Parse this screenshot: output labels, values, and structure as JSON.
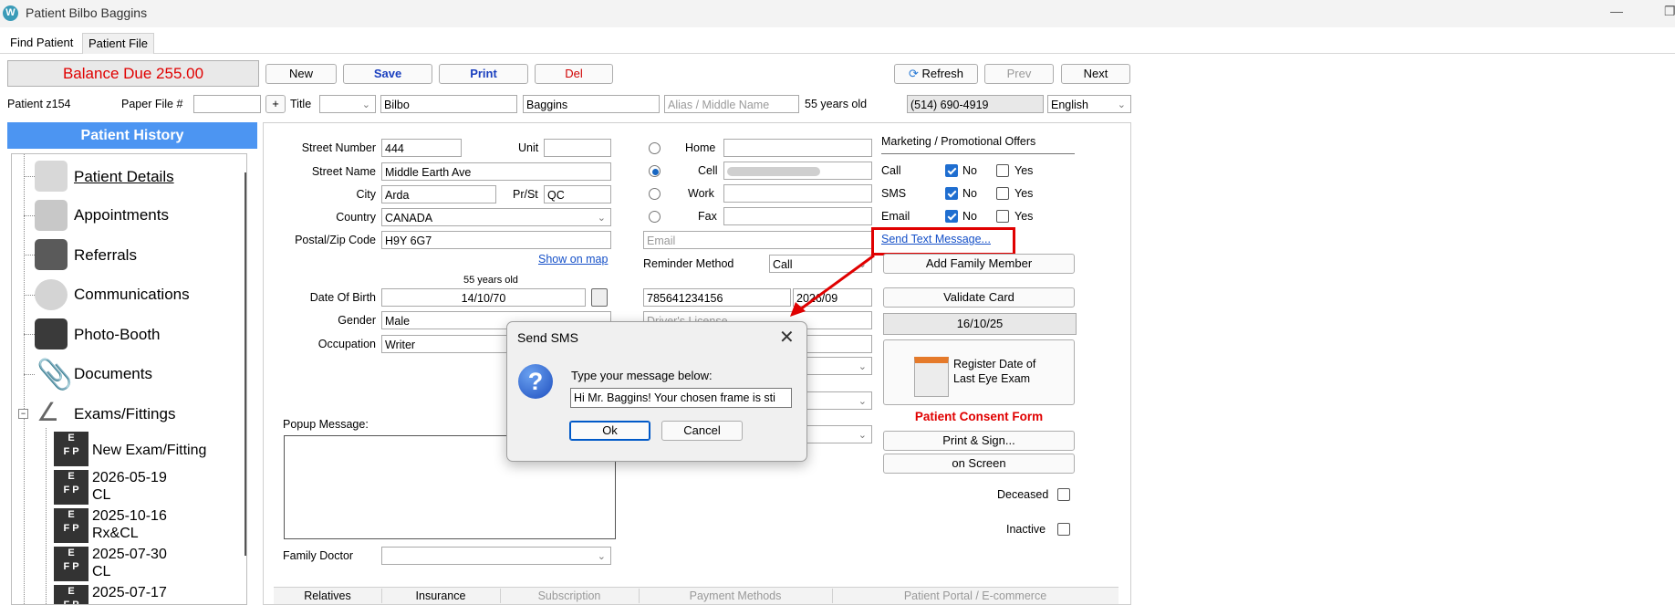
{
  "window": {
    "title": "Patient Bilbo Baggins"
  },
  "tabs": [
    "Find Patient",
    "Patient File"
  ],
  "toolbar": {
    "balance": "Balance Due 255.00",
    "new_label": "New",
    "save_label": "Save",
    "print_label": "Print",
    "del_label": "Del",
    "refresh_label": "Refresh",
    "prev_label": "Prev",
    "next_label": "Next"
  },
  "patient_bar": {
    "patient_id": "Patient z154",
    "paper_file_label": "Paper File #",
    "paper_file_value": "",
    "title_label": "Title",
    "first_name": "Bilbo",
    "last_name": "Baggins",
    "alias_placeholder": "Alias / Middle Name",
    "age": "55 years old",
    "phone": "(514) 690-4919",
    "language": "English"
  },
  "sidebar": {
    "title": "Patient History",
    "items": [
      "Patient Details",
      "Appointments",
      "Referrals",
      "Communications",
      "Photo-Booth",
      "Documents",
      "Exams/Fittings"
    ],
    "exams": [
      {
        "date": "New Exam/Fitting",
        "type": ""
      },
      {
        "date": "2026-05-19",
        "type": "CL"
      },
      {
        "date": "2025-10-16",
        "type": "Rx&CL"
      },
      {
        "date": "2025-07-30",
        "type": "CL"
      },
      {
        "date": "2025-07-17",
        "type": ""
      }
    ]
  },
  "address": {
    "street_number_label": "Street Number",
    "street_number": "444",
    "unit_label": "Unit",
    "unit": "",
    "street_name_label": "Street Name",
    "street_name": "Middle Earth Ave",
    "city_label": "City",
    "city": "Arda",
    "prst_label": "Pr/St",
    "prst": "QC",
    "country_label": "Country",
    "country": "CANADA",
    "postal_label": "Postal/Zip Code",
    "postal": "H9Y 6G7",
    "show_on_map": "Show on map"
  },
  "personal": {
    "age_small": "55 years old",
    "dob_label": "Date Of Birth",
    "dob": "14/10/70",
    "gender_label": "Gender",
    "gender": "Male",
    "occupation_label": "Occupation",
    "occupation": "Writer",
    "popup_label": "Popup Message:",
    "family_doctor_label": "Family Doctor"
  },
  "contact": {
    "home_label": "Home",
    "cell_label": "Cell",
    "work_label": "Work",
    "fax_label": "Fax",
    "email_placeholder": "Email",
    "reminder_label": "Reminder Method",
    "reminder": "Call",
    "card_number": "785641234156",
    "card_exp": "2026/09",
    "license_placeholder": "Driver's License"
  },
  "marketing": {
    "title": "Marketing / Promotional Offers",
    "rows": [
      {
        "label": "Call",
        "no": "No",
        "yes": "Yes"
      },
      {
        "label": "SMS",
        "no": "No",
        "yes": "Yes"
      },
      {
        "label": "Email",
        "no": "No",
        "yes": "Yes"
      }
    ],
    "send_text": "Send Text Message...",
    "add_family": "Add Family Member",
    "validate_card": "Validate Card",
    "validated_date": "16/10/25",
    "register_exam": "Register Date of Last Eye Exam",
    "consent_title": "Patient Consent Form",
    "print_sign": "Print & Sign...",
    "on_screen": "on Screen",
    "deceased_label": "Deceased",
    "inactive_label": "Inactive"
  },
  "bottom_tabs": [
    "Relatives",
    "Insurance",
    "Subscription",
    "Payment Methods",
    "Patient Portal / E-commerce"
  ],
  "dialog": {
    "title": "Send SMS",
    "prompt": "Type your message below:",
    "message": "Hi Mr. Baggins! Your chosen frame is sti",
    "ok": "Ok",
    "cancel": "Cancel"
  },
  "colors": {
    "accent": "#4c95f2",
    "balance": "#e00000",
    "highlight": "#e00000",
    "link": "#1550c8"
  }
}
